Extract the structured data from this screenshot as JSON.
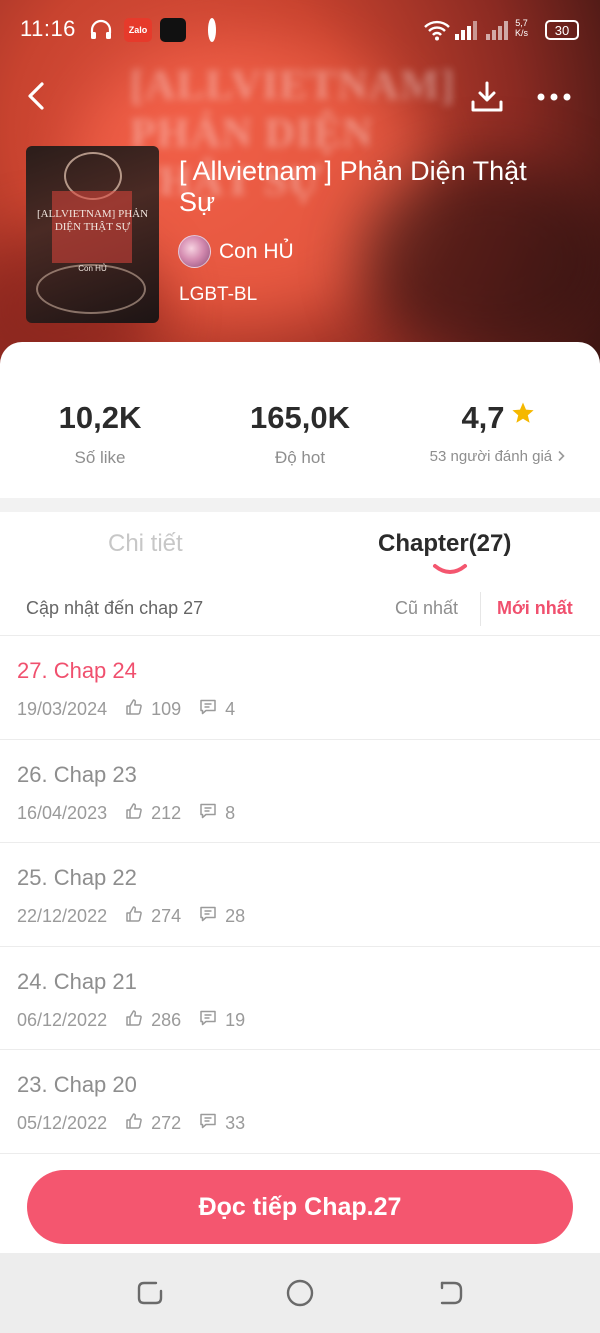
{
  "status_bar": {
    "time": "11:16",
    "zalo": "Zalo",
    "speed_top": "5,7",
    "speed_bottom": "K/s",
    "battery": "30"
  },
  "header": {
    "blur_text": "[ALLVIETNAM] PHẢN DIỆN THẬT SỰ"
  },
  "book": {
    "cover_title": "[ALLVIETNAM] PHẢN DIỆN THẬT SỰ",
    "cover_author": "Con HỦ",
    "title": "[ Allvietnam ] Phản Diện Thật Sự",
    "author": "Con HỦ",
    "genre": "LGBT-BL"
  },
  "stats": [
    {
      "value": "10,2K",
      "label": "Số like"
    },
    {
      "value": "165,0K",
      "label": "Độ hot"
    },
    {
      "value": "4,7",
      "label": "53 người đánh giá"
    }
  ],
  "tabs": {
    "detail": "Chi tiết",
    "chapter": "Chapter(27)"
  },
  "subbar": {
    "updated": "Cập nhật đến chap 27",
    "oldest": "Cũ nhất",
    "newest": "Mới nhất"
  },
  "chapters": [
    {
      "name": "27. Chap 24",
      "date": "19/03/2024",
      "likes": "109",
      "comments": "4"
    },
    {
      "name": "26. Chap 23",
      "date": "16/04/2023",
      "likes": "212",
      "comments": "8"
    },
    {
      "name": "25. Chap 22",
      "date": "22/12/2022",
      "likes": "274",
      "comments": "28"
    },
    {
      "name": "24. Chap 21",
      "date": "06/12/2022",
      "likes": "286",
      "comments": "19"
    },
    {
      "name": "23. Chap 20",
      "date": "05/12/2022",
      "likes": "272",
      "comments": "33"
    }
  ],
  "read_button": "Đọc tiếp Chap.27",
  "colors": {
    "accent": "#f4566f",
    "accent_text": "#f0506e",
    "star": "#f5b800"
  }
}
